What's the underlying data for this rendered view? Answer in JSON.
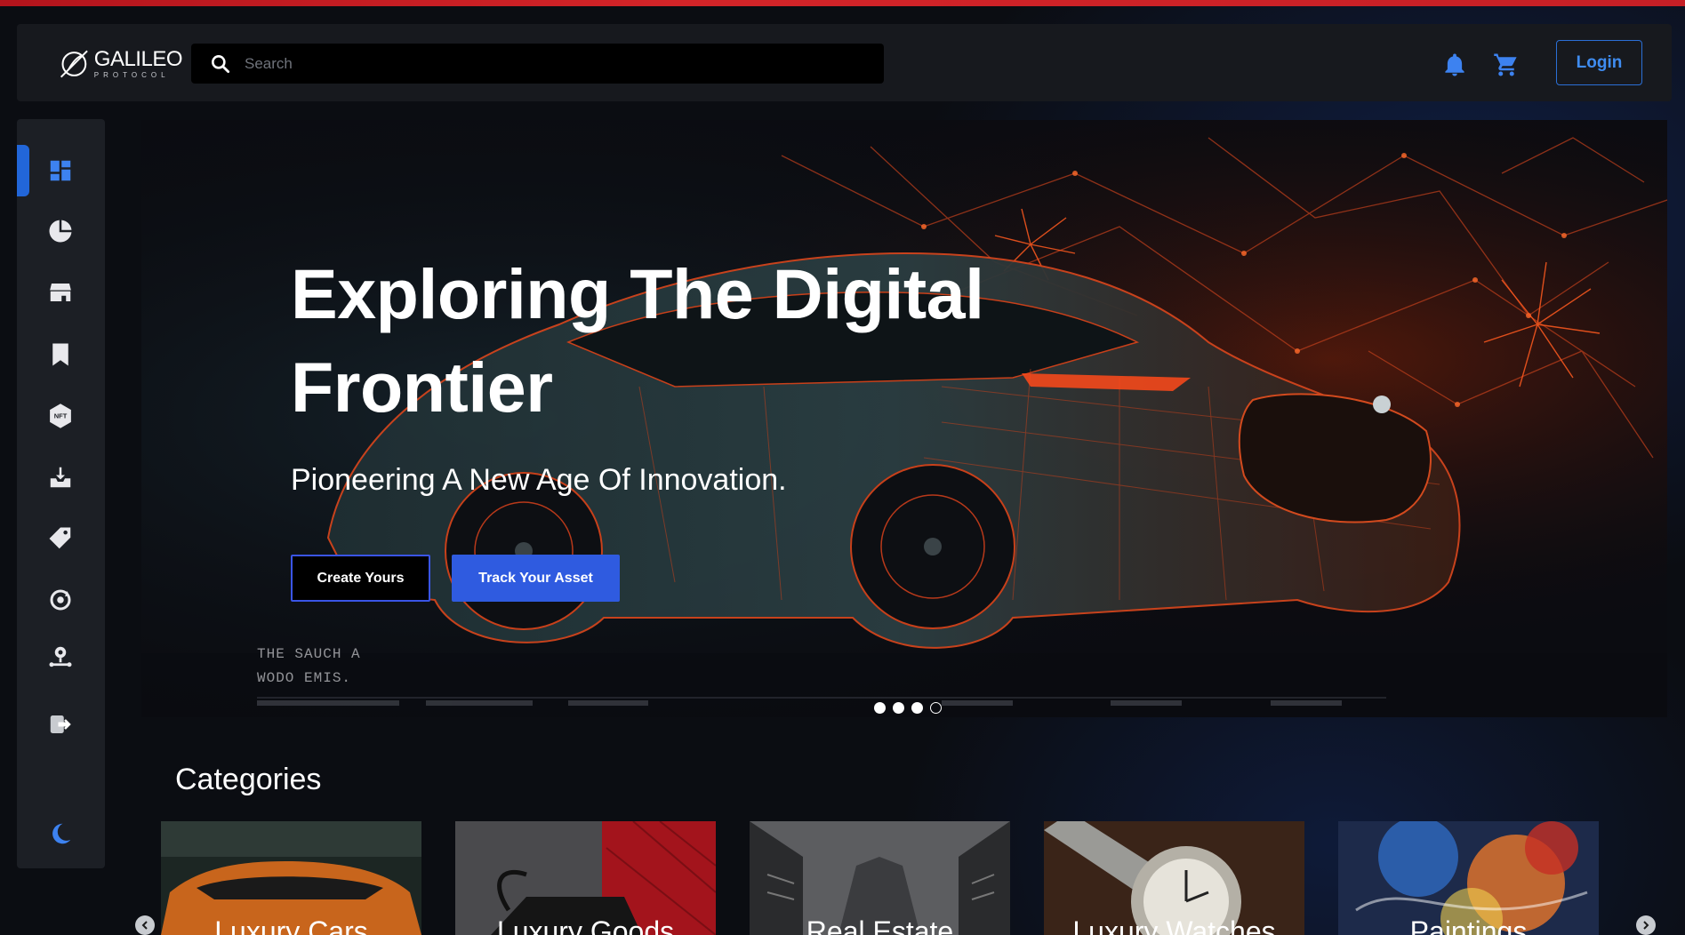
{
  "header": {
    "logo": {
      "name": "GALILEO",
      "tagline": "PROTOCOL"
    },
    "search": {
      "placeholder": "Search",
      "value": ""
    },
    "icons": [
      "bell-icon",
      "cart-icon"
    ],
    "login_label": "Login"
  },
  "sidebar": {
    "items": [
      {
        "icon": "dashboard-icon",
        "active": true
      },
      {
        "icon": "pie-chart-icon"
      },
      {
        "icon": "storefront-icon"
      },
      {
        "icon": "bookmark-icon"
      },
      {
        "icon": "nft-icon"
      },
      {
        "icon": "inbox-download-icon"
      },
      {
        "icon": "tag-icon"
      },
      {
        "icon": "refresh-cycle-icon"
      },
      {
        "icon": "location-network-icon"
      },
      {
        "icon": "logout-icon"
      }
    ],
    "theme_toggle_icon": "moon-icon"
  },
  "hero": {
    "title": "Exploring The Digital Frontier",
    "subtitle": "Pioneering A New Age Of Innovation.",
    "primary_cta": "Create Yours",
    "secondary_cta": "Track Your Asset",
    "caption_line1": "THE SAUCH A",
    "caption_line2": "WODO EMIS.",
    "carousel": {
      "slides": 4,
      "dots": [
        "filled",
        "filled",
        "filled",
        "empty"
      ]
    }
  },
  "categories": {
    "title": "Categories",
    "items": [
      {
        "label": "Luxury Cars"
      },
      {
        "label": "Luxury Goods"
      },
      {
        "label": "Real Estate"
      },
      {
        "label": "Luxury Watches"
      },
      {
        "label": "Paintings"
      }
    ]
  },
  "colors": {
    "accent": "#2f5be0",
    "login_text": "#3f8cf0",
    "top_line": "#d32428",
    "panel": "#1c1f25",
    "icon": "#e8e8ec",
    "active_icon": "#3d82f0"
  }
}
